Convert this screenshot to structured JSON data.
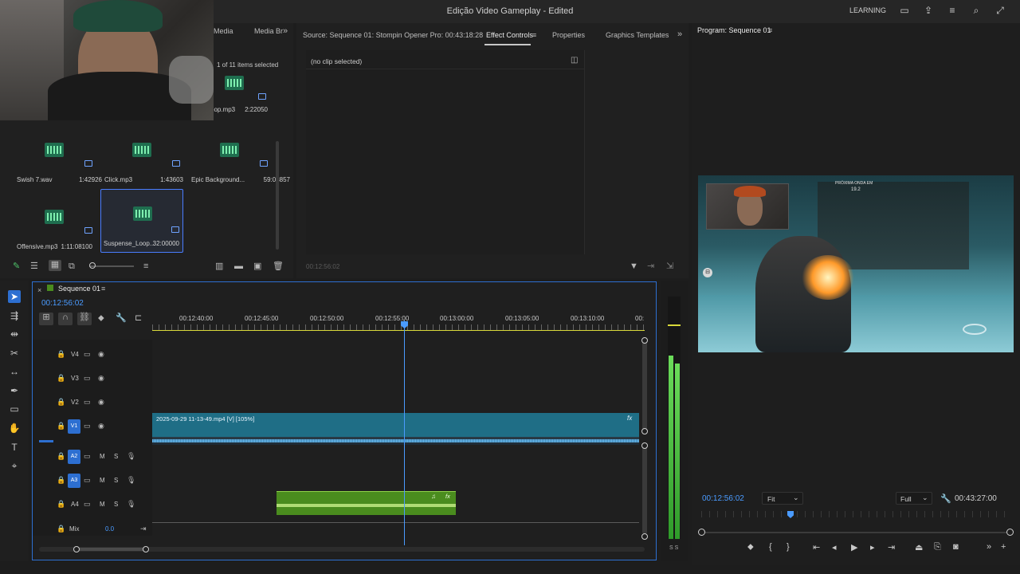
{
  "window": {
    "title": "Edição Video Gameplay - Edited",
    "learning": "LEARNING"
  },
  "project": {
    "tabs": [
      "Media",
      "Media Br"
    ],
    "items_selected": "1 of 11 items selected",
    "items": [
      {
        "name": "oop.mp3",
        "duration": "2:22050"
      },
      {
        "name": "Swish 7.wav",
        "duration": "1:42926"
      },
      {
        "name": "Click.mp3",
        "duration": "1:43603"
      },
      {
        "name": "Epic Background...",
        "duration": "59:03857"
      },
      {
        "name": "Offensive.mp3",
        "duration": "1:11:08100"
      },
      {
        "name": "Suspense_Loop...",
        "duration": "32:00000"
      }
    ]
  },
  "source": {
    "tabs": [
      "Source: Sequence 01: Stompin Opener Pro: 00:43:18:28",
      "Effect Controls",
      "Properties",
      "Graphics Templates"
    ],
    "no_clip": "(no clip selected)",
    "timecode": "00:12:56:02"
  },
  "program": {
    "title": "Program: Sequence 01",
    "timecode": "00:12:56:02",
    "fit": "Fit",
    "quality": "Full",
    "duration": "00:43:27:00",
    "overlay_text": "PRÓXIMA ONDA EM",
    "overlay_number": "19.2"
  },
  "timeline": {
    "sequence_tab": "Sequence 01",
    "timecode": "00:12:56:02",
    "ruler": [
      "00:12:40:00",
      "00:12:45:00",
      "00:12:50:00",
      "00:12:55:00",
      "00:13:00:00",
      "00:13:05:00",
      "00:13:10:00",
      "00:"
    ],
    "tracks": [
      "V4",
      "V3",
      "V2",
      "V1",
      "A2",
      "A3",
      "A4"
    ],
    "mix_label": "Mix",
    "mix_value": "0.0",
    "clip_v1": "2025-09-29 11-13-49.mp4 [V] [105%]",
    "m": "M",
    "s": "S",
    "fx": "fx",
    "meter_labels": "S  S"
  },
  "colors": {
    "accent": "#2d8ceb",
    "v1_clip": "#1f6e86",
    "audio_clip": "#4a8c1e",
    "track_blue": "#2d6fd1"
  }
}
